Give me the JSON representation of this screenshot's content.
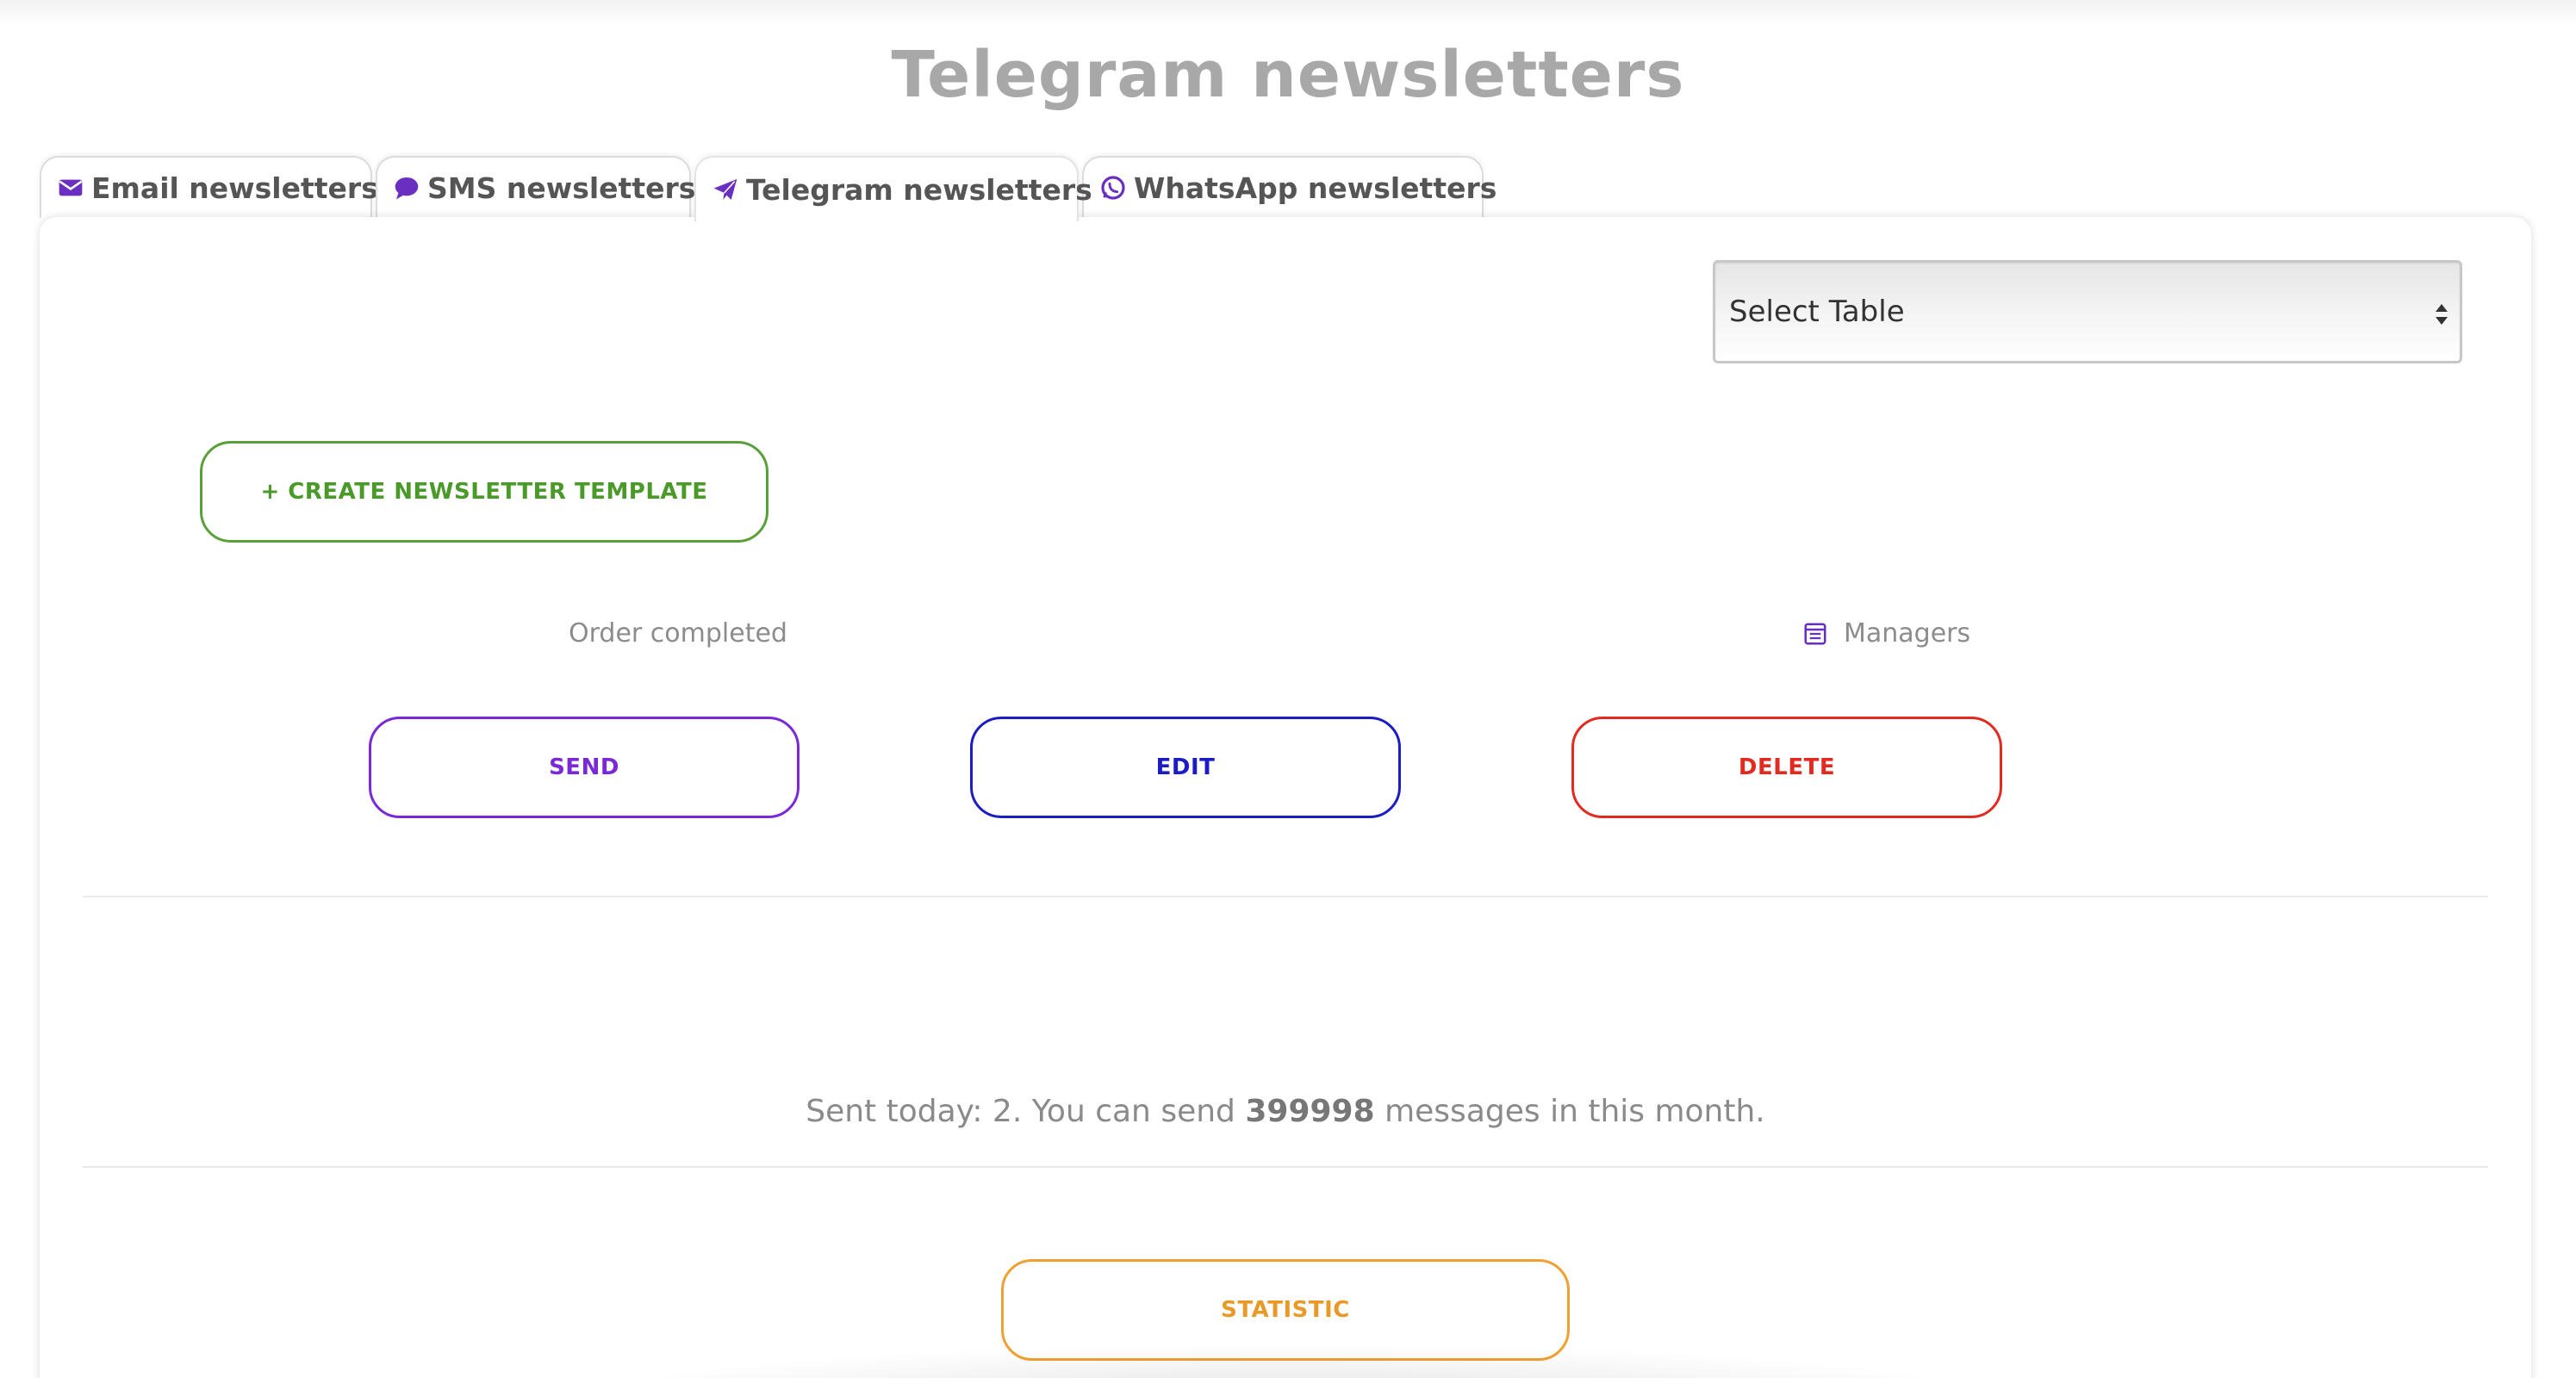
{
  "page": {
    "title": "Telegram newsletters"
  },
  "tabs": [
    {
      "label": "Email newsletters",
      "icon": "envelope-icon",
      "active": false
    },
    {
      "label": "SMS newsletters",
      "icon": "speech-bubble-icon",
      "active": false
    },
    {
      "label": "Telegram newsletters",
      "icon": "paper-plane-icon",
      "active": true
    },
    {
      "label": "WhatsApp newsletters",
      "icon": "whatsapp-icon",
      "active": false
    }
  ],
  "select_table": {
    "selected": "Select Table"
  },
  "actions": {
    "create_label": "+ Create newsletter template",
    "send_label": "Send",
    "edit_label": "Edit",
    "delete_label": "Delete",
    "statistic_label": "Statistic"
  },
  "newsletter": {
    "name": "Order completed",
    "recipients_label": "Managers",
    "recipients_icon": "list-icon"
  },
  "stats": {
    "prefix": "Sent today: 2. You can send ",
    "remaining": "399998",
    "suffix": " messages in this month."
  },
  "colors": {
    "icon_purple": "#6a2fc0",
    "create_green": "#4a9a2a",
    "send_purple": "#7a28d8",
    "edit_blue": "#1c1cc4",
    "delete_red": "#e22a20",
    "statistic_orange": "#e89a28"
  }
}
